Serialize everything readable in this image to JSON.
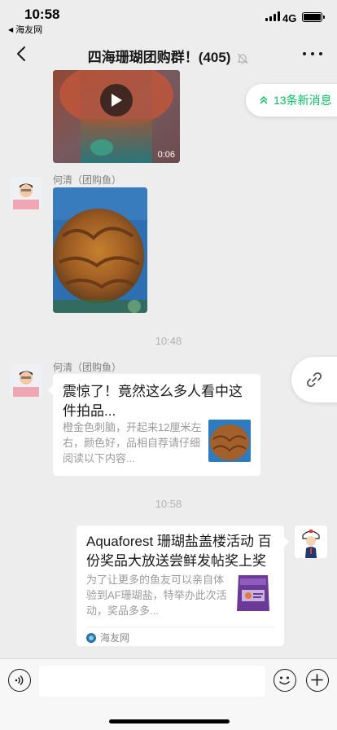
{
  "status_bar": {
    "time": "10:58",
    "back_app": "海友网",
    "network": "4G"
  },
  "nav": {
    "title": "四海珊瑚团购群！(405)",
    "muted": true
  },
  "new_messages": {
    "label": "13条新消息"
  },
  "messages": {
    "video": {
      "duration": "0:06"
    },
    "image_sender": "何清（团购鱼）",
    "time_1": "10:48",
    "link_sender": "何清（团购鱼）",
    "link_1": {
      "title": "震惊了！竟然这么多人看中这件拍品...",
      "desc": "橙金色刺脑，开起来12厘米左右，颜色好，品相自荐请仔细阅读以下内容..."
    },
    "time_2": "10:58",
    "link_2": {
      "title": "Aquaforest 珊瑚盐盖楼活动 百份奖品大放送尝鲜发帖奖上奖",
      "desc": "为了让更多的鱼友可以亲自体验到AF珊瑚盐，特举办此次活动，奖品多多...",
      "source": "海友网"
    }
  },
  "input": {
    "placeholder": ""
  },
  "colors": {
    "accent": "#07c160",
    "background": "#ededed",
    "card": "#ffffff"
  }
}
